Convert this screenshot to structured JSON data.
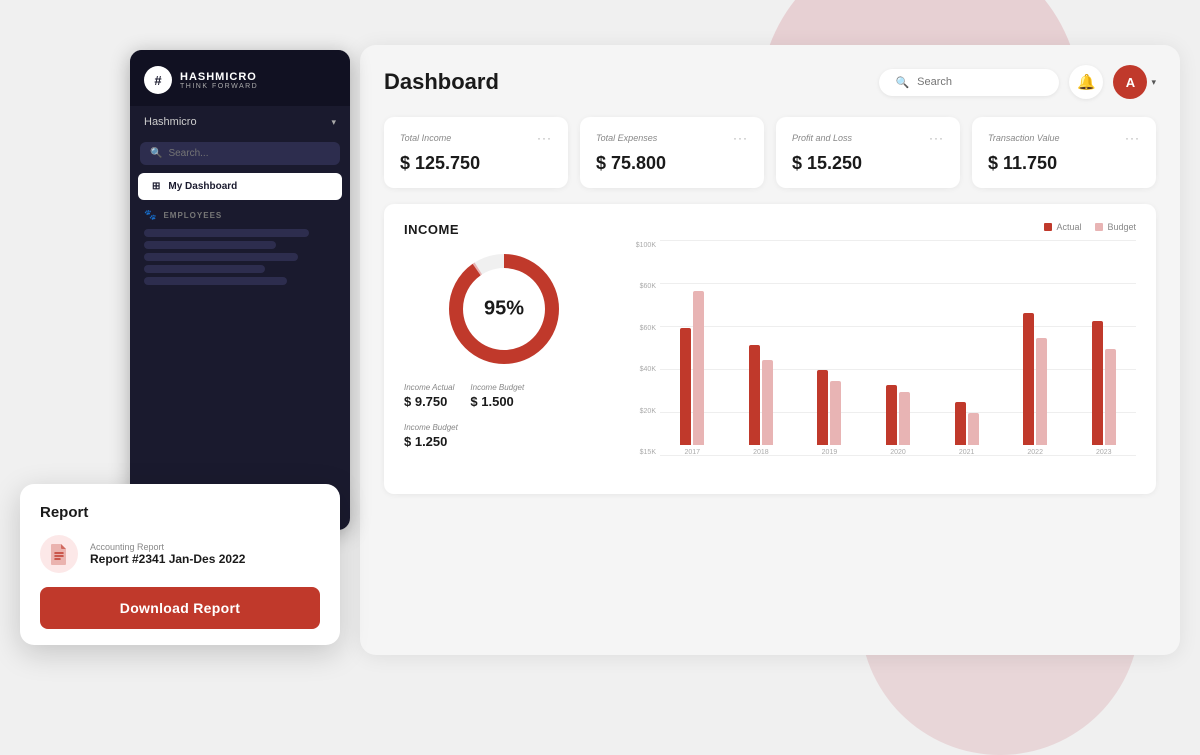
{
  "app": {
    "logo": {
      "icon": "#",
      "name": "HASHMICRO",
      "tagline": "THINK FORWARD"
    },
    "org_name": "Hashmicro",
    "search_placeholder": "Search..."
  },
  "sidebar": {
    "menu_items": [
      {
        "label": "My Dashboard",
        "icon": "⊞",
        "active": true
      }
    ],
    "section_label": "EMPLOYEES",
    "bars": [
      1,
      2,
      3,
      4,
      5
    ]
  },
  "report_card": {
    "title": "Report",
    "file_type": "Accounting Report",
    "file_name": "Report #2341 Jan-Des 2022",
    "download_label": "Download Report"
  },
  "header": {
    "title": "Dashboard",
    "search_placeholder": "Search",
    "notif_icon": "🔔",
    "avatar_initial": "A"
  },
  "stats": [
    {
      "label": "Total Income",
      "value": "$ 125.750"
    },
    {
      "label": "Total Expenses",
      "value": "$ 75.800"
    },
    {
      "label": "Profit and Loss",
      "value": "$ 15.250"
    },
    {
      "label": "Transaction Value",
      "value": "$ 11.750"
    }
  ],
  "income": {
    "title": "INCOME",
    "donut_percent": "95%",
    "legend": {
      "actual": "Actual",
      "budget": "Budget"
    },
    "actual_label": "Income Actual",
    "actual_value": "$ 9.750",
    "budget_label": "Income Budget",
    "budget_value": "$ 1.500",
    "budget2_label": "Income Budget",
    "budget2_value": "$ 1.250",
    "chart": {
      "y_labels": [
        "$100K",
        "$60K",
        "$60K",
        "$40K",
        "$20K",
        "$15K"
      ],
      "bars": [
        {
          "year": "2017",
          "actual": 55,
          "budget": 72
        },
        {
          "year": "2018",
          "actual": 47,
          "budget": 40
        },
        {
          "year": "2019",
          "actual": 35,
          "budget": 30
        },
        {
          "year": "2020",
          "actual": 28,
          "budget": 25
        },
        {
          "year": "2021",
          "actual": 20,
          "budget": 15
        },
        {
          "year": "2022",
          "actual": 62,
          "budget": 50
        },
        {
          "year": "2023",
          "actual": 58,
          "budget": 45
        }
      ],
      "max_height": 180
    }
  },
  "colors": {
    "brand": "#c0392b",
    "sidebar_bg": "#1a1a2e",
    "sidebar_search": "#2d2d4e"
  }
}
